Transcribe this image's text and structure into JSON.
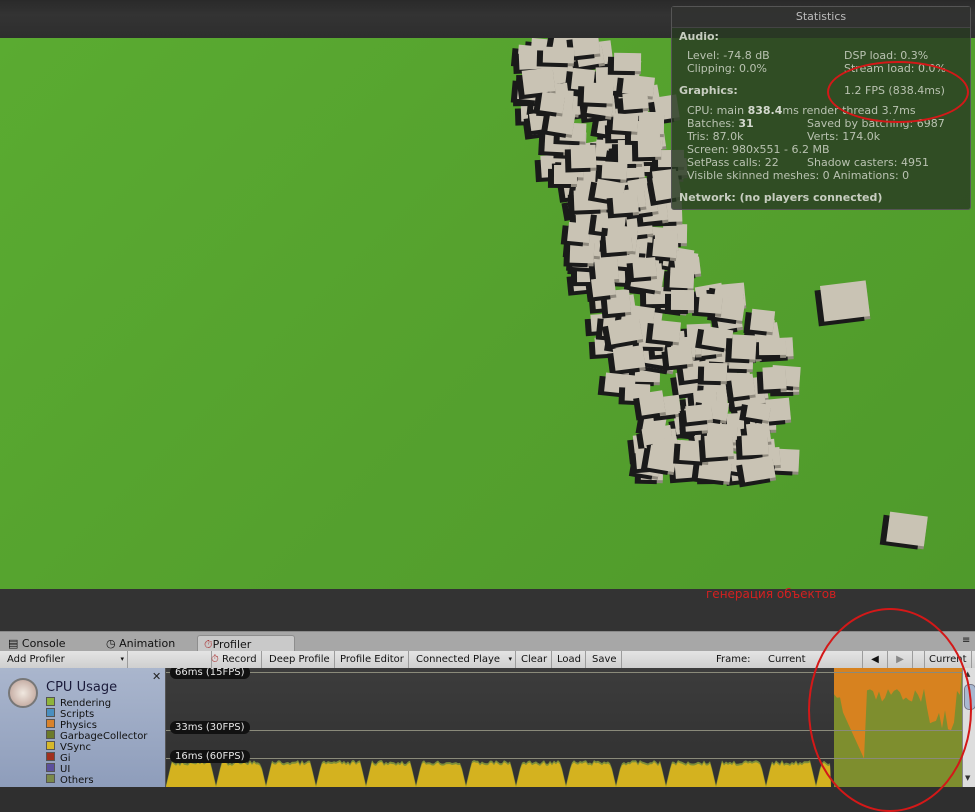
{
  "statistics": {
    "title": "Statistics",
    "audio_header": "Audio:",
    "audio_level": "Level: -74.8 dB",
    "audio_clipping": "Clipping: 0.0%",
    "dsp_load": "DSP load: 0.3%",
    "stream_load": "Stream load: 0.0%",
    "graphics_header": "Graphics:",
    "fps": "1.2 FPS (838.4ms)",
    "cpu_prefix": "CPU: main ",
    "cpu_main": "838.4",
    "cpu_suffix": "ms  render thread 3.7ms",
    "batches_prefix": "Batches: ",
    "batches": "31",
    "saved_by_batching": "Saved by batching: 6987",
    "tris": "Tris: 87.0k",
    "verts": "Verts: 174.0k",
    "screen": "Screen: 980x551 - 6.2 MB",
    "setpass": "SetPass calls: 22",
    "shadow_casters": "Shadow casters: 4951",
    "skinned": "Visible skinned meshes: 0  Animations: 0",
    "network": "Network: (no players connected)"
  },
  "annotation": {
    "text": "генерация объектов",
    "color": "#d41818"
  },
  "tabs": [
    {
      "label": "Console",
      "icon": "console-icon"
    },
    {
      "label": "Animation",
      "icon": "clock-icon"
    },
    {
      "label": "Profiler",
      "icon": "profiler-icon",
      "active": true
    }
  ],
  "toolbar": {
    "add_profiler": "Add Profiler",
    "record": "Record",
    "deep_profile": "Deep Profile",
    "profile_editor": "Profile Editor",
    "connected_player": "Connected Playe",
    "clear": "Clear",
    "load": "Load",
    "save": "Save",
    "frame_label": "Frame:",
    "frame_value": "Current",
    "current_button": "Current"
  },
  "cpu_legend": {
    "title": "CPU Usage",
    "items": [
      {
        "label": "Rendering",
        "color": "#8fb43a"
      },
      {
        "label": "Scripts",
        "color": "#4a8fc0"
      },
      {
        "label": "Physics",
        "color": "#d9822b"
      },
      {
        "label": "GarbageCollector",
        "color": "#6b7a2a"
      },
      {
        "label": "VSync",
        "color": "#d6b82a"
      },
      {
        "label": "Gi",
        "color": "#a0301e"
      },
      {
        "label": "UI",
        "color": "#5c4f9c"
      },
      {
        "label": "Others",
        "color": "#7b8a4a"
      }
    ]
  },
  "graph": {
    "labels": [
      "66ms (15FPS)",
      "33ms (30FPS)",
      "16ms (60FPS)"
    ]
  }
}
